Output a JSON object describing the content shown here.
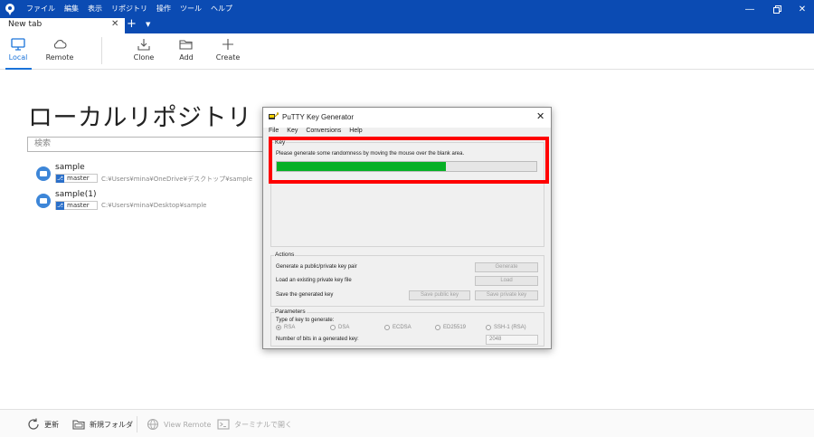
{
  "menu": [
    "ファイル",
    "編集",
    "表示",
    "リポジトリ",
    "操作",
    "ツール",
    "ヘルプ"
  ],
  "tabs": {
    "active_label": "New tab"
  },
  "toolbar": {
    "local": "Local",
    "remote": "Remote",
    "clone": "Clone",
    "add": "Add",
    "create": "Create"
  },
  "main": {
    "title": "ローカルリポジトリ",
    "search_placeholder": "検索",
    "repos": [
      {
        "name": "sample",
        "branch": "master",
        "path": "C:¥Users¥mina¥OneDrive¥デスクトップ¥sample"
      },
      {
        "name": "sample(1)",
        "branch": "master",
        "path": "C:¥Users¥mina¥Desktop¥sample"
      }
    ]
  },
  "bottombar": {
    "refresh": "更新",
    "new_folder": "新規フォルダ",
    "view_remote": "View Remote",
    "terminal": "ターミナルで開く"
  },
  "putty": {
    "title": "PuTTY Key Generator",
    "menu": [
      "File",
      "Key",
      "Conversions",
      "Help"
    ],
    "key_group": "Key",
    "key_message": "Please generate some randomness by moving the mouse over the blank area.",
    "progress": 0.65,
    "actions_group": "Actions",
    "actions": {
      "generate_label": "Generate a public/private key pair",
      "generate_btn": "Generate",
      "load_label": "Load an existing private key file",
      "load_btn": "Load",
      "save_label": "Save the generated key",
      "save_public_btn": "Save public key",
      "save_private_btn": "Save private key"
    },
    "params_group": "Parameters",
    "key_type_label": "Type of key to generate:",
    "key_types": [
      "RSA",
      "DSA",
      "ECDSA",
      "ED25519",
      "SSH-1 (RSA)"
    ],
    "bits_label": "Number of bits in a generated key:",
    "bits_value": "2048"
  },
  "colors": {
    "titlebar": "#0b4bb3",
    "accent": "#1a73d9",
    "progress": "#06b025",
    "highlight": "#ff0000"
  }
}
